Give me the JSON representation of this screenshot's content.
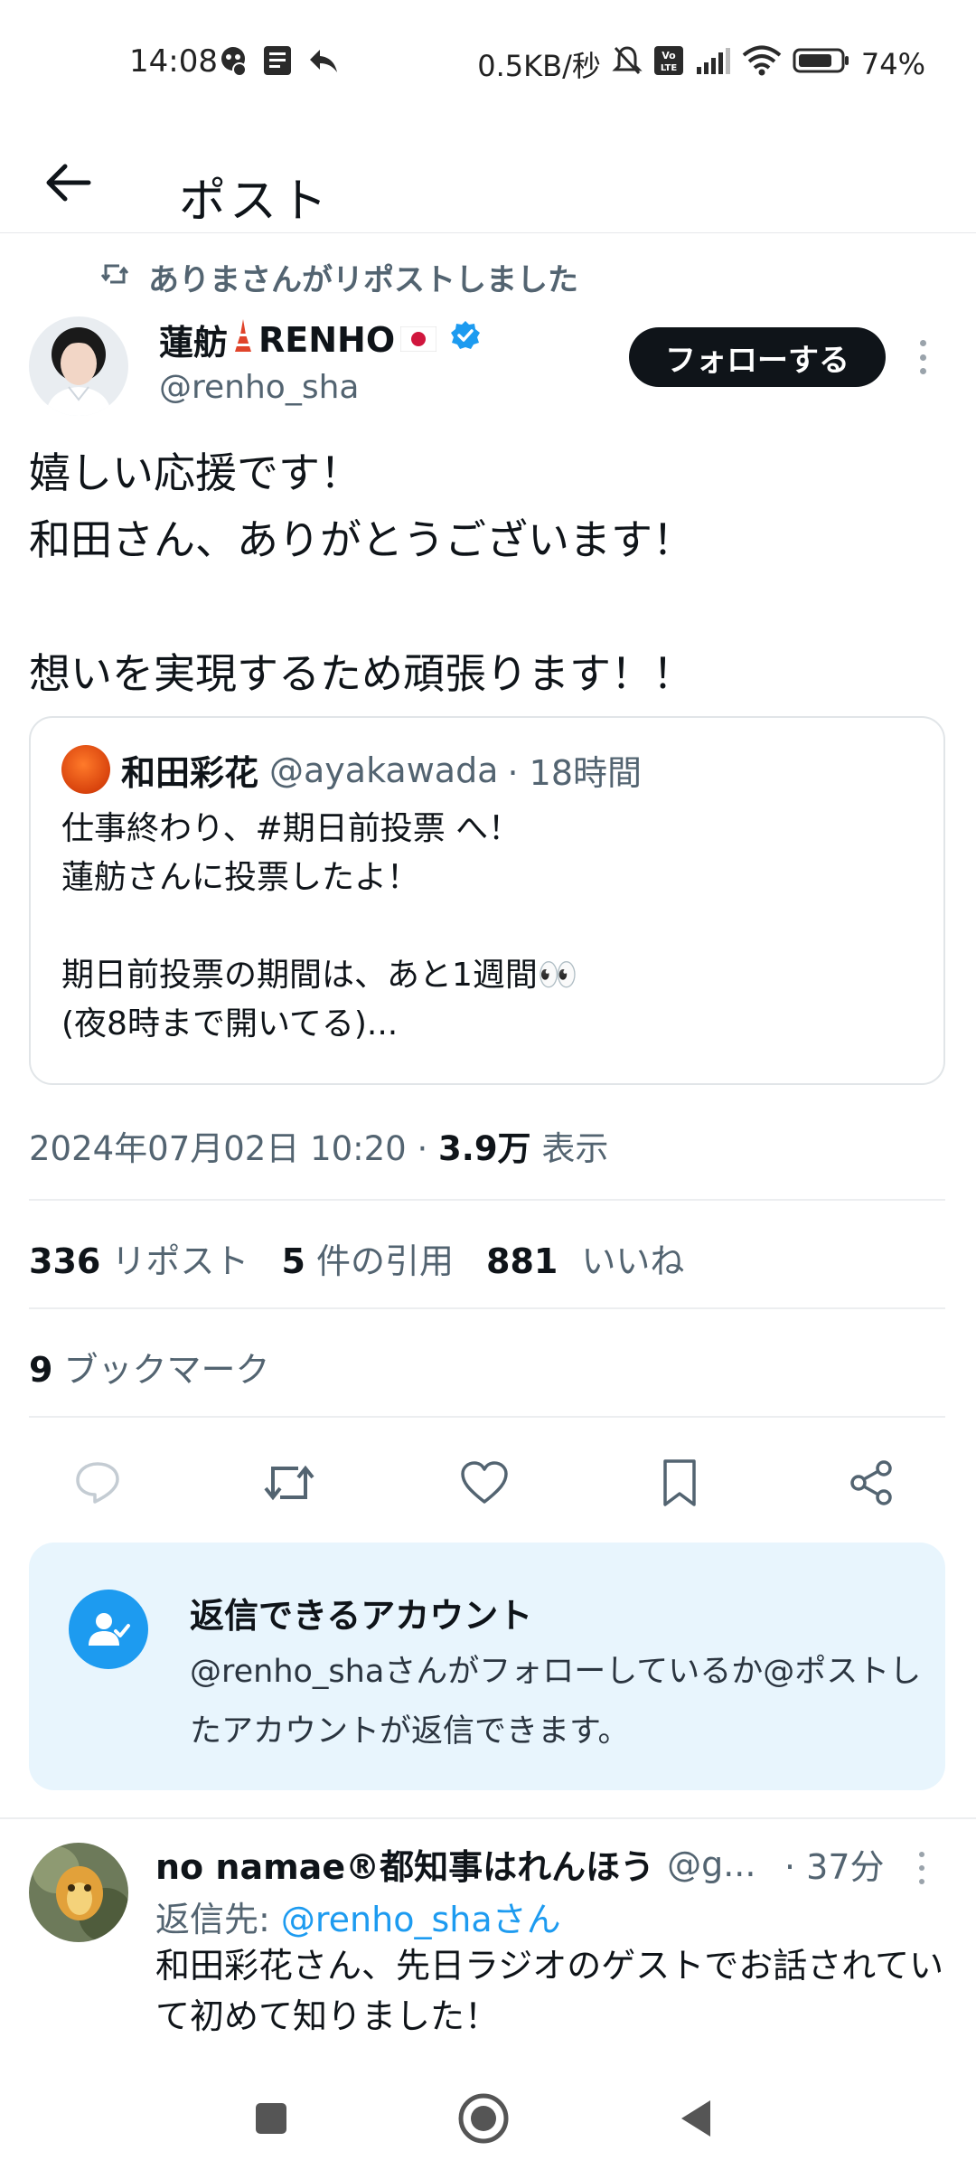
{
  "status_bar": {
    "time": "14:08",
    "network_speed": "0.5KB/秒",
    "battery": "74%",
    "volte": "VoLTE"
  },
  "header": {
    "title": "ポスト"
  },
  "repost_context": {
    "text": "ありまさんがリポストしました"
  },
  "post": {
    "author_name": "蓮舫",
    "author_name_suffix": "RENHO",
    "author_handle": "@renho_sha",
    "follow_label": "フォローする",
    "text_lines": [
      "嬉しい応援です！",
      "和田さん、ありがとうございます！",
      "",
      "想いを実現するため頑張ります！！"
    ],
    "timestamp": "2024年07月02日 10:20",
    "views_value": "3.9万",
    "views_label": "表示",
    "reposts_count": "336",
    "reposts_label": "リポスト",
    "quotes_count": "5",
    "quotes_label": "件の引用",
    "likes_count": "881",
    "likes_label": "いいね",
    "bookmarks_count": "9",
    "bookmarks_label": "ブックマーク"
  },
  "quote": {
    "name": "和田彩花",
    "handle": "@ayakawada",
    "time": "· 18時間",
    "lines": [
      "仕事終わり、#期日前投票 へ！",
      "蓮舫さんに投票したよ！",
      "",
      "期日前投票の期間は、あと1週間👀",
      "(夜8時まで開いてる)..."
    ]
  },
  "reply_restriction": {
    "title": "返信できるアカウント",
    "text": "@renho_shaさんがフォローしているか@ポストしたアカウントが返信できます。"
  },
  "reply": {
    "name": "no namae®都知事はれんほう",
    "handle": "@g...",
    "time": "· 37分",
    "reply_to_prefix": "返信先: ",
    "reply_to_link": "@renho_shaさん",
    "text": "和田彩花さん、先日ラジオのゲストでお話されていて初めて知りました！"
  },
  "colors": {
    "accent": "#1d9bf0",
    "text": "#0f1419",
    "muted": "#536471",
    "card_bg": "#e8f5fd"
  }
}
